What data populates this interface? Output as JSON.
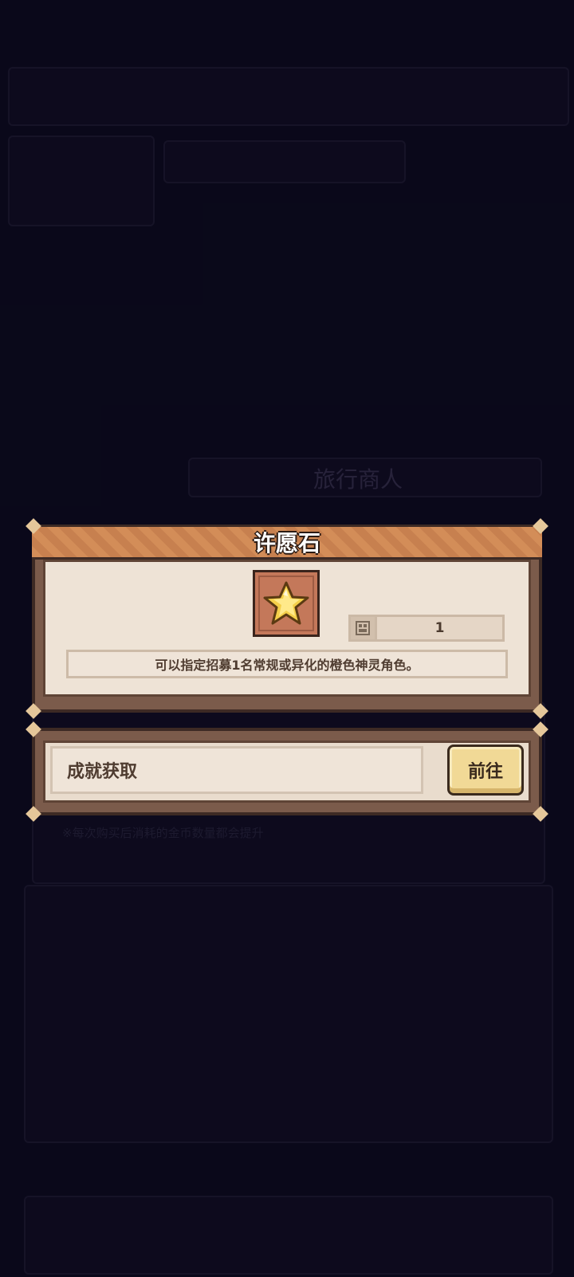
{
  "background": {
    "shop_title": "旅行商人",
    "tip_1": "※每次购买后消耗的金币数量都会提升"
  },
  "item_popup": {
    "title": "许愿石",
    "item_icon": "star-icon",
    "owned_count": "1",
    "description": "可以指定招募1名常规或异化的橙色神灵角色。"
  },
  "source_popup": {
    "source_label": "成就获取",
    "go_button": "前往"
  },
  "colors": {
    "panel_border": "#7b5b4b",
    "panel_inner": "#eee3d6",
    "banner": "#d38d58",
    "button": "#f1d996"
  }
}
